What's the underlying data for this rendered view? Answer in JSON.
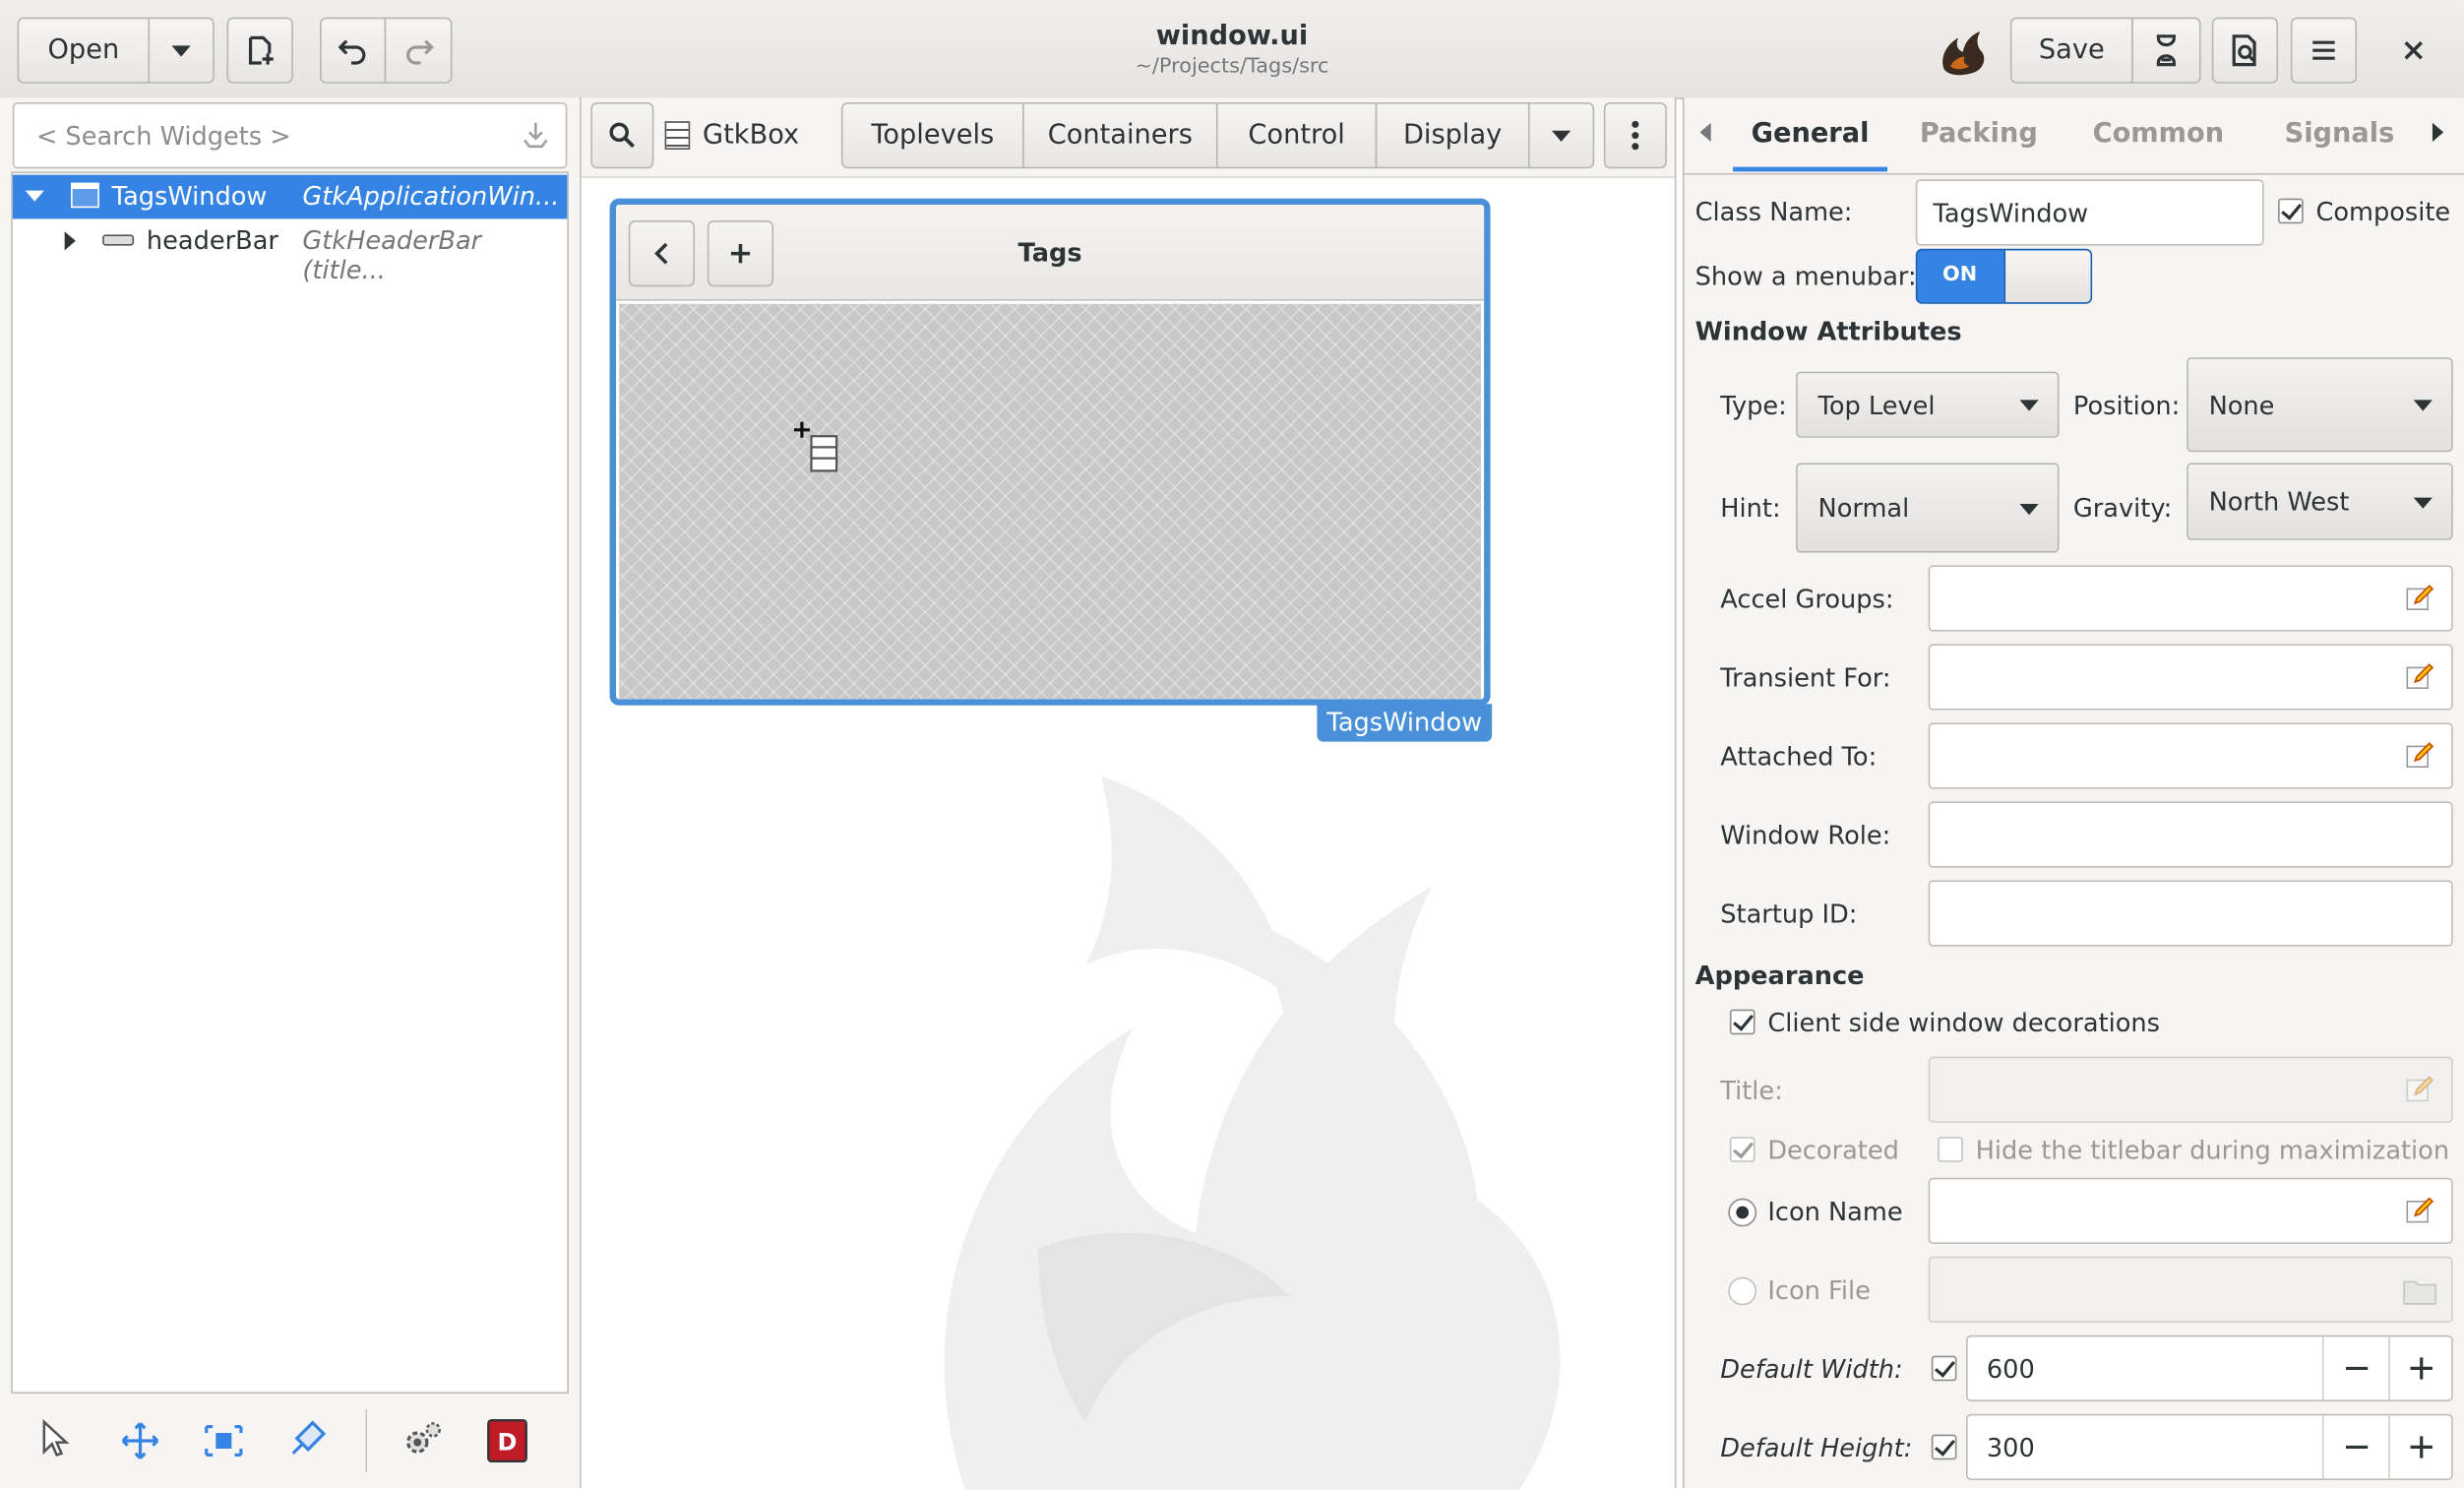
{
  "window": {
    "title": "window.ui",
    "subtitle": "~/Projects/Tags/src"
  },
  "header": {
    "open_label": "Open",
    "save_label": "Save"
  },
  "sidebar": {
    "search_placeholder": "< Search Widgets >",
    "tree": [
      {
        "name": "TagsWindow",
        "type": "GtkApplicationWin..."
      },
      {
        "name": "headerBar",
        "type": "GtkHeaderBar (title..."
      }
    ]
  },
  "toolbar": {
    "current_widget": "GtkBox",
    "tabs": [
      "Toplevels",
      "Containers",
      "Control",
      "Display"
    ]
  },
  "canvas": {
    "window_title": "Tags",
    "window_label": "TagsWindow"
  },
  "inspector": {
    "tabs": [
      "General",
      "Packing",
      "Common",
      "Signals"
    ],
    "active_tab": "General",
    "class_name_label": "Class Name:",
    "class_name_value": "TagsWindow",
    "composite_label": "Composite",
    "show_menubar_label": "Show a menubar:",
    "switch_on_text": "ON",
    "window_attributes_heading": "Window Attributes",
    "type_label": "Type:",
    "type_value": "Top Level",
    "position_label": "Position:",
    "position_value": "None",
    "hint_label": "Hint:",
    "hint_value": "Normal",
    "gravity_label": "Gravity:",
    "gravity_value": "North West",
    "accel_groups_label": "Accel Groups:",
    "transient_for_label": "Transient For:",
    "attached_to_label": "Attached To:",
    "window_role_label": "Window Role:",
    "startup_id_label": "Startup ID:",
    "appearance_heading": "Appearance",
    "csd_label": "Client side window decorations",
    "title_label": "Title:",
    "decorated_label": "Decorated",
    "hide_titlebar_label": "Hide the titlebar during maximization",
    "icon_name_label": "Icon Name",
    "icon_file_label": "Icon File",
    "default_width_label": "Default Width:",
    "default_width_value": "600",
    "default_height_label": "Default Height:",
    "default_height_value": "300"
  }
}
